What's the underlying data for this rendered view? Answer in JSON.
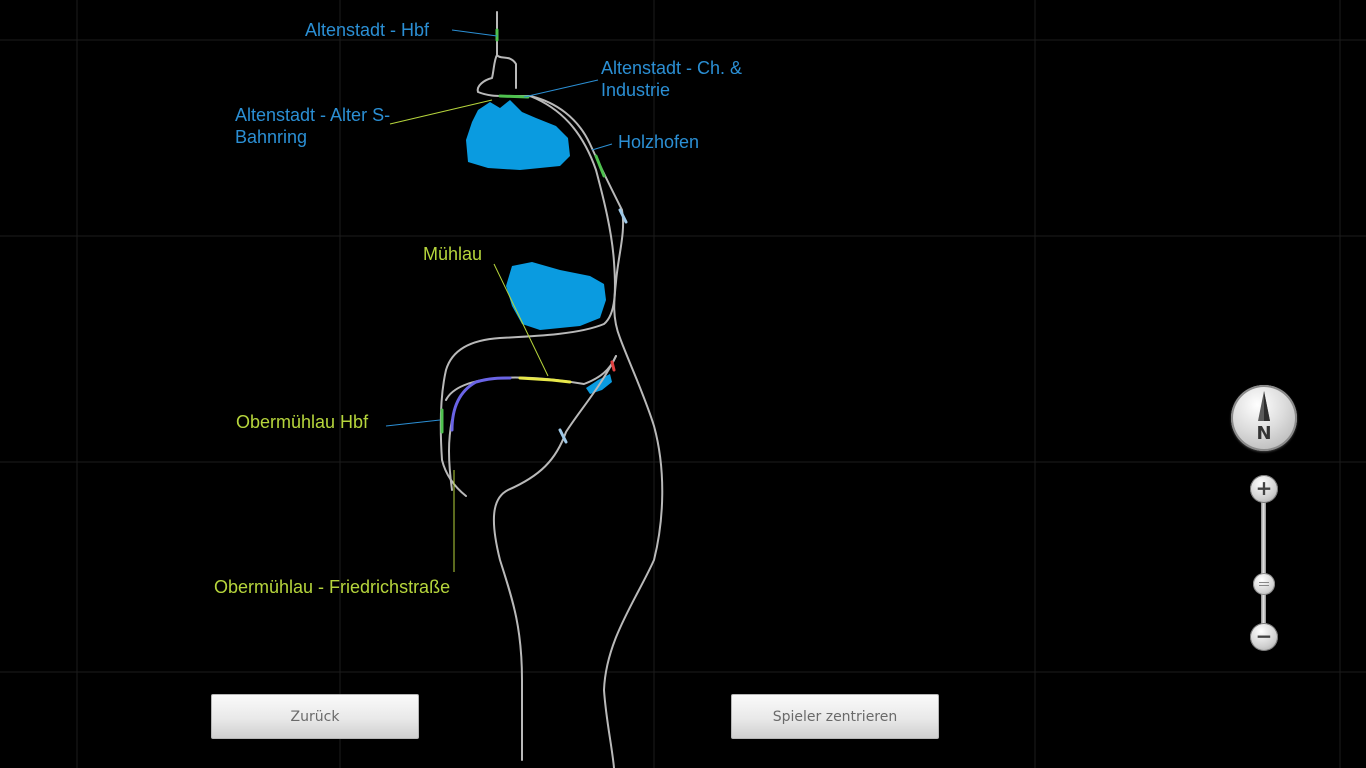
{
  "map": {
    "stations": [
      {
        "name": "Altenstadt - Hbf",
        "color": "#2b8fd4"
      },
      {
        "name": "Altenstadt - Ch. & Industrie",
        "color": "#2b8fd4"
      },
      {
        "name": "Altenstadt - Alter S-Bahnring",
        "color": "#2b8fd4"
      },
      {
        "name": "Holzhofen",
        "color": "#2b8fd4"
      },
      {
        "name": "Mühlau",
        "color": "#b6d53c"
      },
      {
        "name": "Obermühlau Hbf",
        "color": "#b6d53c"
      },
      {
        "name": "Obermühlau - Friedrichstraße",
        "color": "#b6d53c"
      }
    ],
    "label_lines": {
      "ch_industrie_1": "Altenstadt - Ch. &",
      "ch_industrie_2": "Industrie",
      "alter_1": "Altenstadt - Alter S-",
      "alter_2": "Bahnring"
    },
    "colors": {
      "background": "#000000",
      "grid": "#1c1c1c",
      "track": "#b9b9b9",
      "water": "#0a9be0",
      "blue_label": "#2b8fd4",
      "green_label": "#b6d53c"
    }
  },
  "controls": {
    "back_label": "Zurück",
    "center_label": "Spieler zentrieren",
    "compass_letter": "N",
    "zoom_in_icon": "plus-icon",
    "zoom_out_icon": "minus-icon",
    "zoom_plus": "+",
    "zoom_minus": "−",
    "zoom_level": 0.2
  }
}
